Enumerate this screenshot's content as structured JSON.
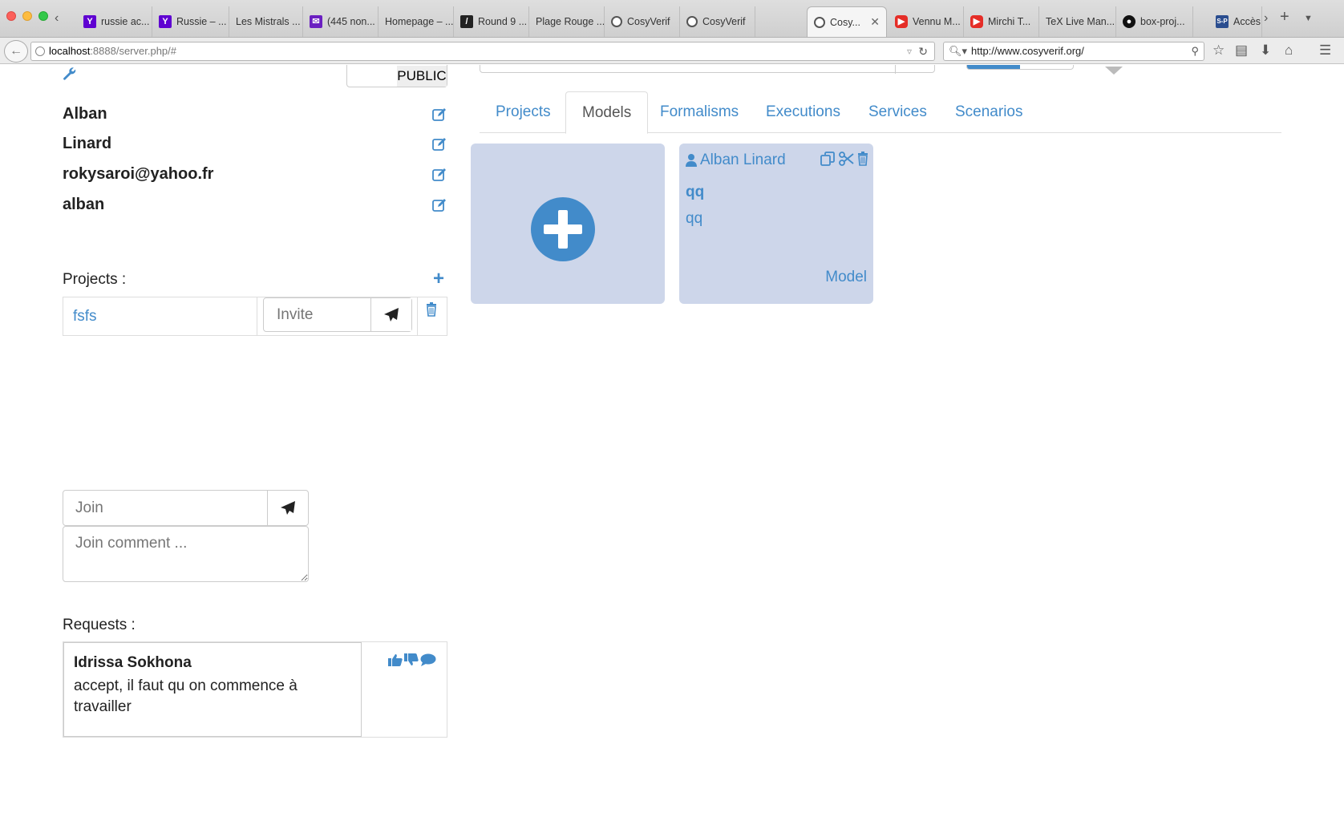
{
  "browser": {
    "tabs": [
      {
        "label": "russie ac...",
        "favicon": "yahoo"
      },
      {
        "label": "Russie – ...",
        "favicon": "yahoo"
      },
      {
        "label": "Les Mistrals ...",
        "favicon": "none"
      },
      {
        "label": "(445 non...",
        "favicon": "mail"
      },
      {
        "label": "Homepage – ...",
        "favicon": "none"
      },
      {
        "label": "Round 9 ...",
        "favicon": "round"
      },
      {
        "label": "Plage Rouge ...",
        "favicon": "none"
      },
      {
        "label": "CosyVerif",
        "favicon": "cosy"
      },
      {
        "label": "CosyVerif",
        "favicon": "cosy"
      },
      {
        "label": "Cosy...",
        "favicon": "cosy",
        "active": true
      },
      {
        "label": "Vennu M...",
        "favicon": "youtube"
      },
      {
        "label": "Mirchi T...",
        "favicon": "youtube"
      },
      {
        "label": "TeX Live Man...",
        "favicon": "none"
      },
      {
        "label": "box-proj...",
        "favicon": "github"
      },
      {
        "label": "Accès",
        "favicon": "sp"
      }
    ],
    "url_host": "localhost",
    "url_path": ":8888/server.php/#",
    "search_value": "http://www.cosyverif.org/"
  },
  "user_panel": {
    "visibility_label": "PUBLIC",
    "first_name": "Alban",
    "last_name": "Linard",
    "email": "rokysaroi@yahoo.fr",
    "login": "alban",
    "projects_heading": "Projects :",
    "projects": [
      {
        "name": "fsfs",
        "invite_placeholder": "Invite"
      }
    ],
    "join_placeholder": "Join",
    "join_comment_placeholder": "Join comment ...",
    "requests_heading": "Requests :",
    "requests": [
      {
        "user": "Idrissa Sokhona",
        "message": "accept, il faut qu on commence à travailler"
      }
    ]
  },
  "main": {
    "tabs": [
      "Projects",
      "Models",
      "Formalisms",
      "Executions",
      "Services",
      "Scenarios"
    ],
    "active_tab": "Models",
    "models": [
      {
        "owner": "Alban Linard",
        "title": "qq",
        "description": "qq",
        "type": "Model"
      }
    ]
  },
  "colors": {
    "accent": "#428bca",
    "card_bg": "#cdd6ea"
  }
}
